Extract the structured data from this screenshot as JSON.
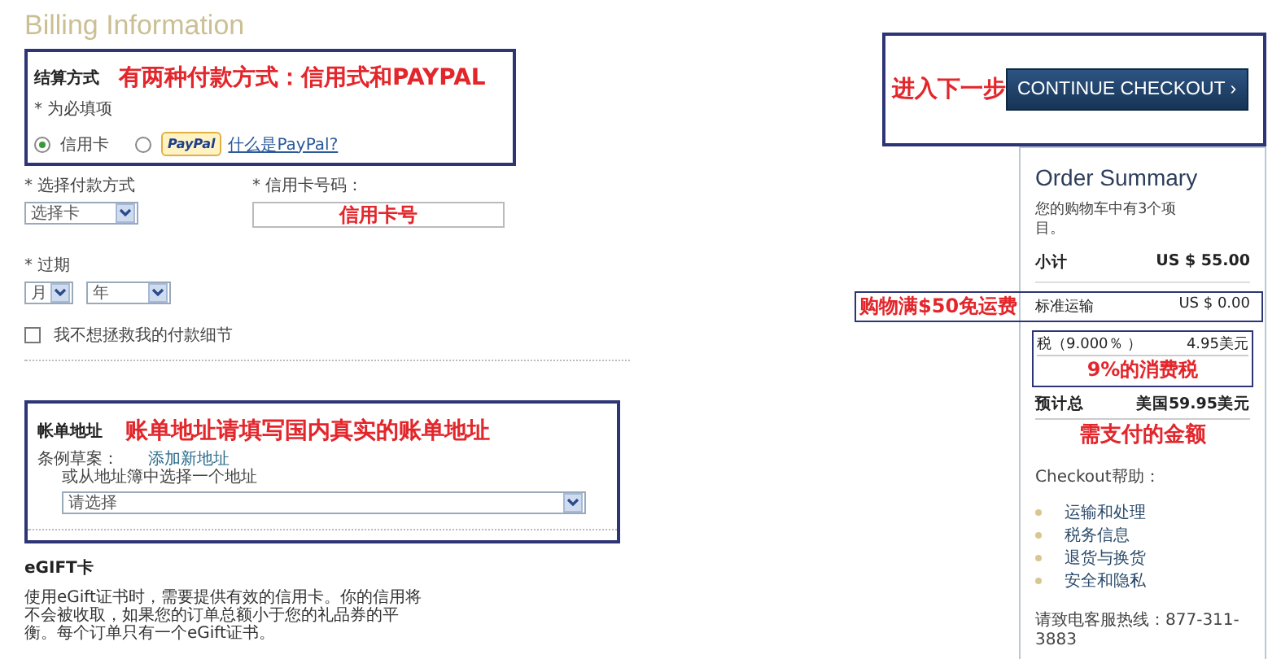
{
  "title": "Billing Information",
  "payment": {
    "heading": "结算方式",
    "note": "有两种付款方式：信用式和PAYPAL",
    "required": "* 为必填项",
    "link": "什么是PayPal?",
    "options": [
      {
        "kind": "text",
        "label": "信用卡",
        "selected": true
      },
      {
        "kind": "paypal",
        "label": "PayPal",
        "selected": false
      }
    ]
  },
  "card_type": {
    "label": "* 选择付款方式",
    "value": "选择卡"
  },
  "card_number": {
    "label": "* 信用卡号码：",
    "note": "信用卡号"
  },
  "expiry": {
    "label": "* 过期",
    "month": "月",
    "year": "年"
  },
  "save_details": {
    "label": "我不想拯救我的付款细节",
    "checked": false
  },
  "billing_address": {
    "heading": "帐单地址",
    "note": "账单地址请填写国内真实的账单地址",
    "label": "条例草案：",
    "link": "添加新地址",
    "hint": "或从地址簿中选择一个地址",
    "value": "请选择"
  },
  "egift": {
    "heading": "eGIFT卡",
    "text": "使用eGift证书时，需要提供有效的信用卡。你的信用将不会被收取，如果您的订单总额小于您的礼品券的平衡。每个订单只有一个eGift证书。"
  },
  "continue": {
    "note": "进入下一步",
    "button": "CONTINUE CHECKOUT",
    "arrow": "›"
  },
  "summary": {
    "title": "Order Summary",
    "cart": "您的购物车中有3个项目。",
    "rows": [
      {
        "kind": "plain",
        "label": "小计",
        "value": "US $ 55.00",
        "bold": true
      },
      {
        "kind": "side-note",
        "label": "标准运输",
        "value": "US $ 0.00",
        "bold": false,
        "note": "购物满$50免运费"
      },
      {
        "kind": "framed",
        "label": "税（9.000％ ）",
        "value": "4.95美元",
        "bold": false,
        "note": "9%的消费税"
      },
      {
        "kind": "below-note",
        "label": "预计总",
        "value": "美国59.95美元",
        "bold": true,
        "note": "需支付的金额"
      }
    ],
    "help_title": "Checkout帮助：",
    "help_links": [
      "运输和处理",
      "税务信息",
      "退货与换货",
      "安全和隐私"
    ],
    "hotline": "请致电客服热线：877-311-3883"
  }
}
